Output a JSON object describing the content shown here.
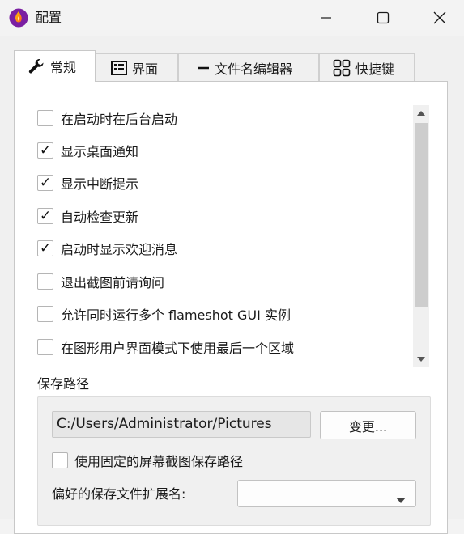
{
  "window": {
    "title": "配置",
    "icon": "flameshot-icon"
  },
  "tabs": [
    {
      "label": "常规",
      "icon": "wrench-icon",
      "active": true
    },
    {
      "label": "界面",
      "icon": "interface-icon",
      "active": false
    },
    {
      "label": "文件名编辑器",
      "icon": "minus-icon",
      "active": false
    },
    {
      "label": "快捷键",
      "icon": "grid-icon",
      "active": false
    }
  ],
  "options": [
    {
      "label": "在启动时在后台启动",
      "checked": false
    },
    {
      "label": "显示桌面通知",
      "checked": true
    },
    {
      "label": "显示中断提示",
      "checked": true
    },
    {
      "label": "自动检查更新",
      "checked": true
    },
    {
      "label": "启动时显示欢迎消息",
      "checked": true
    },
    {
      "label": "退出截图前请询问",
      "checked": false
    },
    {
      "label": "允许同时运行多个 flameshot GUI 实例",
      "checked": false
    },
    {
      "label": "在图形用户界面模式下使用最后一个区域",
      "checked": false
    }
  ],
  "check_mark": "✓",
  "save_path": {
    "group_label": "保存路径",
    "path_value": "C:/Users/Administrator/Pictures",
    "change_button": "变更...",
    "use_fixed_label": "使用固定的屏幕截图保存路径",
    "use_fixed_checked": false,
    "extension_label": "偏好的保存文件扩展名:",
    "extension_value": ""
  },
  "colors": {
    "brand_start": "#ffb300",
    "brand_end": "#7b1fa2"
  }
}
